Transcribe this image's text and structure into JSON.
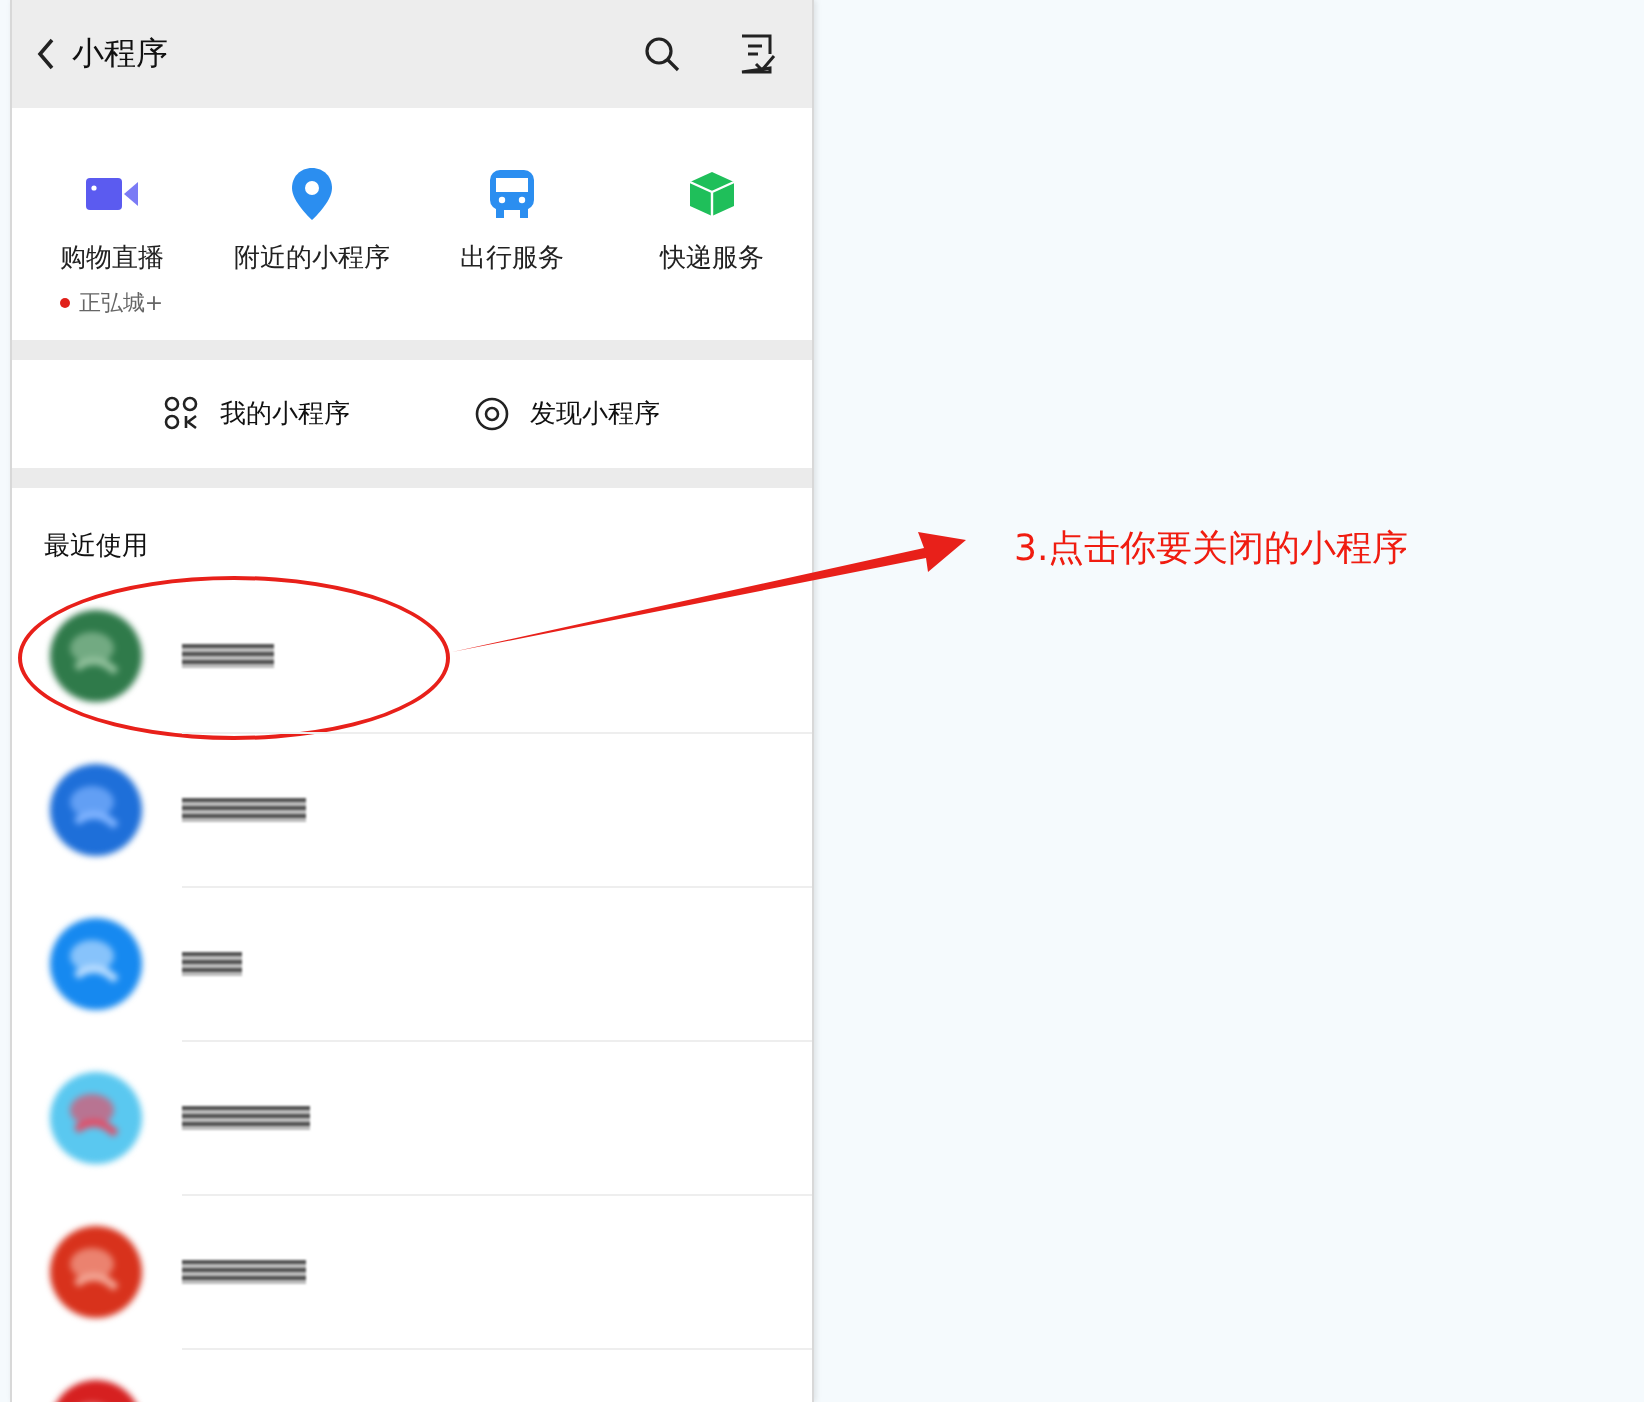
{
  "top_bar": {
    "title": "小程序"
  },
  "quick_services": [
    {
      "kind": "video",
      "label": "购物直播",
      "note": "正弘城+"
    },
    {
      "kind": "pin",
      "label": "附近的小程序"
    },
    {
      "kind": "bus",
      "label": "出行服务"
    },
    {
      "kind": "box",
      "label": "快递服务"
    }
  ],
  "links": [
    {
      "kind": "mine",
      "label": "我的小程序"
    },
    {
      "kind": "discover",
      "label": "发现小程序"
    }
  ],
  "recent": {
    "heading": "最近使用",
    "apps": [
      {
        "kind": "picture",
        "circled": true
      },
      {
        "kind": "picture",
        "circled": false
      },
      {
        "kind": "picture",
        "circled": false
      },
      {
        "kind": "picture",
        "circled": false
      },
      {
        "kind": "picture",
        "circled": false
      },
      {
        "kind": "picture",
        "circled": false
      }
    ]
  },
  "annotation": {
    "text": "3.点击你要关闭的小程序"
  }
}
